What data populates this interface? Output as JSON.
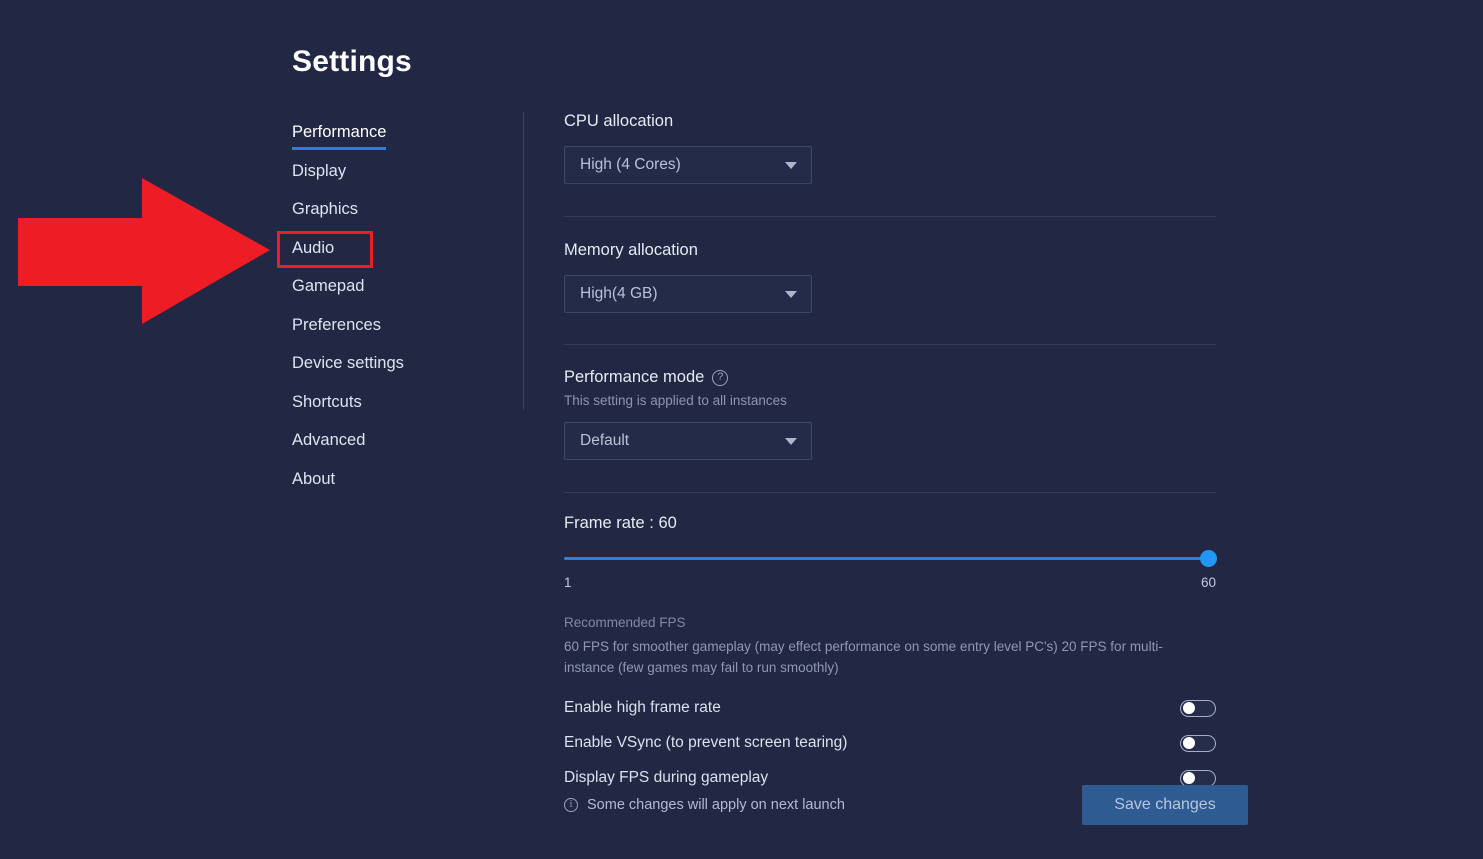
{
  "page": {
    "title": "Settings",
    "background_color": "#222843",
    "accent_color": "#2b7de0"
  },
  "sidebar": {
    "items": [
      {
        "label": "Performance",
        "active": true
      },
      {
        "label": "Display",
        "active": false
      },
      {
        "label": "Graphics",
        "active": false
      },
      {
        "label": "Audio",
        "active": false
      },
      {
        "label": "Gamepad",
        "active": false
      },
      {
        "label": "Preferences",
        "active": false
      },
      {
        "label": "Device settings",
        "active": false
      },
      {
        "label": "Shortcuts",
        "active": false
      },
      {
        "label": "Advanced",
        "active": false
      },
      {
        "label": "About",
        "active": false
      }
    ]
  },
  "main": {
    "cpu": {
      "label": "CPU allocation",
      "value": "High (4 Cores)",
      "caret_icon": "chevron-down-icon"
    },
    "memory": {
      "label": "Memory allocation",
      "value": "High(4 GB)",
      "caret_icon": "chevron-down-icon"
    },
    "performance_mode": {
      "label": "Performance mode",
      "help_icon": "help-circle-icon",
      "subtitle": "This setting is applied to all instances",
      "value": "Default",
      "caret_icon": "chevron-down-icon"
    },
    "frame_rate": {
      "label": "Frame rate : 60",
      "value": 60,
      "min_label": "1",
      "max_label": "60",
      "min": 1,
      "max": 60,
      "thumb_color": "#2196f3",
      "track_color": "#2b7de0"
    },
    "recommended": {
      "title": "Recommended FPS",
      "body": "60 FPS for smoother gameplay (may effect performance on some entry level PC's) 20 FPS for multi-instance (few games may fail to run smoothly)"
    },
    "toggles": [
      {
        "label": "Enable high frame rate",
        "on": false
      },
      {
        "label": "Enable VSync (to prevent screen tearing)",
        "on": false
      },
      {
        "label": "Display FPS during gameplay",
        "on": false
      }
    ]
  },
  "footer": {
    "info_icon": "info-circle-icon",
    "note": "Some changes will apply on next launch",
    "save_label": "Save changes",
    "save_color": "#2e5c92"
  },
  "annotation": {
    "arrow_icon": "right-arrow-annotation",
    "highlight_icon": "highlight-box-annotation",
    "color": "#ee1c25",
    "target": "Audio"
  }
}
